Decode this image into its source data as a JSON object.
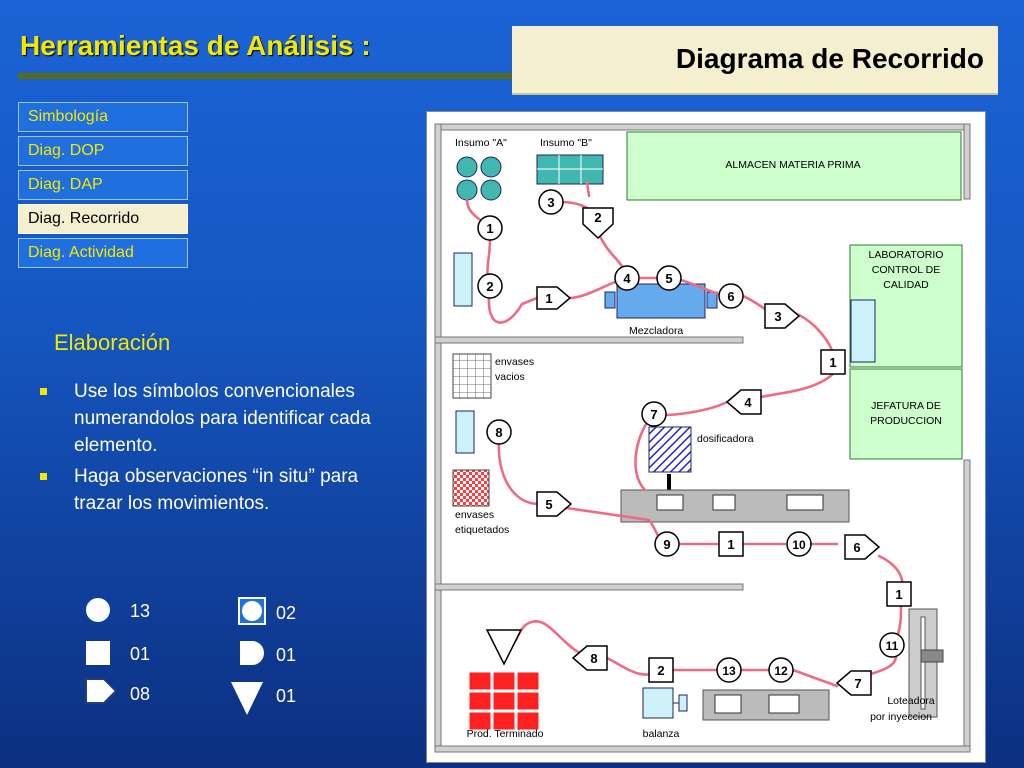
{
  "header": {
    "title": "Herramientas de Análisis :",
    "subtitle": "Diagrama de Recorrido"
  },
  "nav": {
    "items": [
      {
        "label": "Simbología"
      },
      {
        "label": "Diag. DOP"
      },
      {
        "label": "Diag. DAP"
      },
      {
        "label": "Diag. Recorrido"
      },
      {
        "label": "Diag. Actividad"
      }
    ],
    "active_index": 3
  },
  "section": {
    "heading": "Elaboración",
    "bullets": [
      "Use los símbolos convencionales numerandolos para identificar cada elemento.",
      "Haga observaciones “in situ” para trazar los movimientos."
    ]
  },
  "legend": {
    "operation_count": "13",
    "inspection_count": "01",
    "transport_count": "08",
    "combined_count": "02",
    "delay_count": "01",
    "storage_count": "01"
  },
  "diagram": {
    "labels": {
      "insumo_a": "Insumo \"A\"",
      "insumo_b": "Insumo \"B\"",
      "almacen": "ALMACEN MATERIA PRIMA",
      "laboratorio": [
        "LABORATORIO",
        "CONTROL DE",
        "CALIDAD"
      ],
      "jefatura": [
        "JEFATURA DE",
        "PRODUCCION"
      ],
      "mezcladora": "Mezcladora",
      "envases_vacios": [
        "envases",
        "vacios"
      ],
      "dosificadora": "dosificadora",
      "envases_etiquetados": [
        "envases",
        "etiquetados"
      ],
      "loteadora": [
        "Loteadora",
        "por inyeccion"
      ],
      "prod_terminado": "Prod. Terminado",
      "balanza": "balanza"
    },
    "operations": [
      "1",
      "2",
      "4",
      "5",
      "6",
      "7",
      "8",
      "9",
      "10",
      "11",
      "12",
      "13",
      "3"
    ],
    "transports": [
      "1",
      "2",
      "3",
      "4",
      "5",
      "6",
      "7",
      "8"
    ],
    "inspections": [
      "1",
      "1",
      "1",
      "2"
    ]
  },
  "colors": {
    "path": "#f06a86",
    "area_green": "#ccffcc",
    "area_border": "#2f7a2f",
    "equipment_blue": "#66aaee",
    "light_cyan": "#ccf2f7",
    "red": "#ff2020",
    "teal": "#40b8b0",
    "nav_yellow": "#f5e800"
  }
}
